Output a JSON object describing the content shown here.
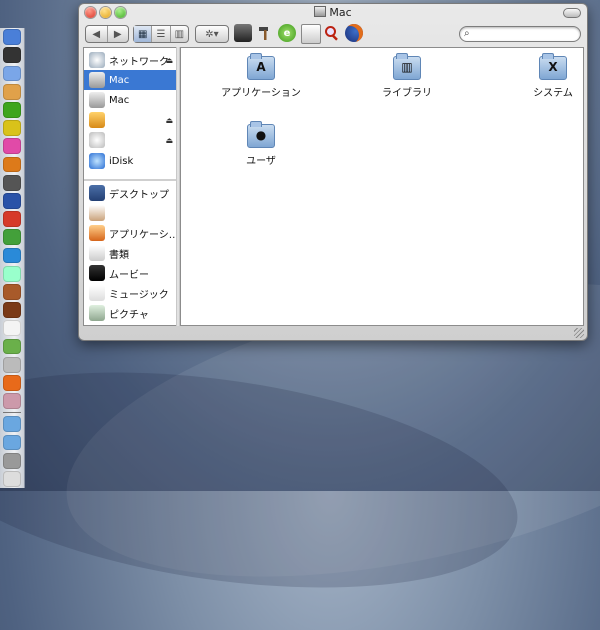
{
  "window": {
    "title": "Mac"
  },
  "toolbar": {
    "back_label": "◀",
    "forward_label": "▶",
    "view_icon_label": "▦",
    "view_list_label": "☰",
    "view_column_label": "▥",
    "action_label": "✲▾",
    "search_placeholder": "",
    "icons": [
      "camera-icon",
      "hammer-icon",
      "browser-e-icon",
      "preview-icon",
      "search-magnifier-icon",
      "firefox-icon"
    ]
  },
  "sidebar": {
    "items": [
      {
        "label": "ネットワーク",
        "icon": "network-icon",
        "eject": "⏏",
        "selected": false
      },
      {
        "label": "Mac",
        "icon": "hard-drive-icon",
        "eject": "",
        "selected": true
      },
      {
        "label": "Mac",
        "icon": "hard-drive-icon",
        "eject": "",
        "selected": false
      },
      {
        "label": "",
        "icon": "external-drive-icon",
        "eject": "⏏",
        "selected": false
      },
      {
        "label": "",
        "icon": "disc-icon",
        "eject": "⏏",
        "selected": false
      },
      {
        "label": "iDisk",
        "icon": "idisk-icon",
        "eject": "",
        "selected": false
      },
      {
        "label": "デスクトップ",
        "icon": "desktop-icon",
        "eject": "",
        "selected": false
      },
      {
        "label": "",
        "icon": "home-icon",
        "eject": "",
        "selected": false
      },
      {
        "label": "アプリケーシ…",
        "icon": "applications-icon",
        "eject": "",
        "selected": false
      },
      {
        "label": "書類",
        "icon": "documents-icon",
        "eject": "",
        "selected": false
      },
      {
        "label": "ムービー",
        "icon": "movies-icon",
        "eject": "",
        "selected": false
      },
      {
        "label": "ミュージック",
        "icon": "music-icon",
        "eject": "",
        "selected": false
      },
      {
        "label": "ピクチャ",
        "icon": "pictures-icon",
        "eject": "",
        "selected": false
      }
    ]
  },
  "content": {
    "items": [
      {
        "label": "アプリケーション",
        "icon": "applications-folder-icon",
        "glyph": "A"
      },
      {
        "label": "ライブラリ",
        "icon": "library-folder-icon",
        "glyph": "▥"
      },
      {
        "label": "システム",
        "icon": "system-folder-icon",
        "glyph": "X"
      },
      {
        "label": "ユーザ",
        "icon": "users-folder-icon",
        "glyph": "●"
      }
    ]
  },
  "dock": {
    "items": [
      "finder-icon",
      "dashboard-icon",
      "mail-icon",
      "ichat-icon",
      "safari-icon",
      "app-ts-icon",
      "photo-icon",
      "itunes-icon",
      "lightroom-icon",
      "system-icon",
      "preview-icon",
      "app-green-icon",
      "app-blue-icon",
      "ipod-icon",
      "app-mix-icon",
      "photo-booth-icon",
      "ical-icon",
      "app-list-icon",
      "apple-icon",
      "firefox-icon",
      "app-tool-icon",
      "folder-icon",
      "folder-icon",
      "stack-icon",
      "trash-icon"
    ]
  },
  "colors": {
    "selection": "#3a78d3",
    "desktop": "#5a6d8c"
  }
}
